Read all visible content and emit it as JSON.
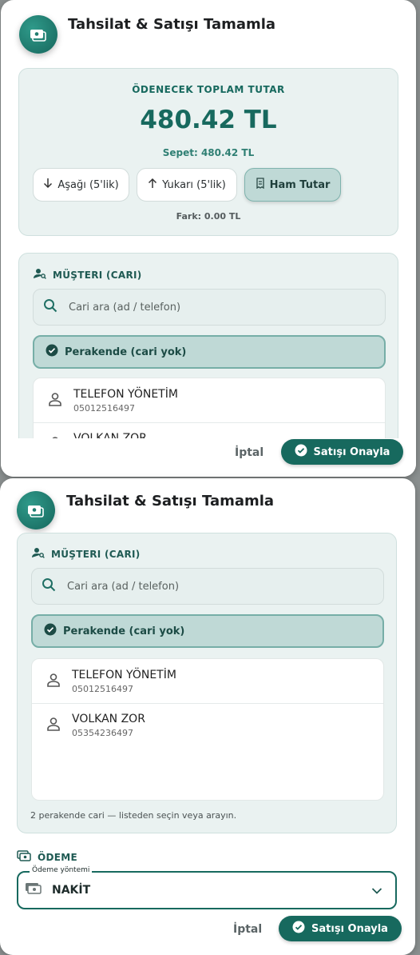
{
  "header": {
    "title": "Tahsilat & Satışı Tamamla",
    "icon": "cash-icon"
  },
  "total": {
    "label": "ÖDENECEK TOPLAM TUTAR",
    "amount": "480.42 TL",
    "basket": "Sepet: 480.42 TL",
    "round_down": "Aşağı (5'lik)",
    "round_up": "Yukarı (5'lik)",
    "raw": "Ham Tutar",
    "diff": "Fark: 0.00 TL"
  },
  "customer": {
    "title": "MÜŞTERI (CARI)",
    "search_placeholder": "Cari ara (ad / telefon)",
    "retail_label": "Perakende (cari yok)",
    "items": [
      {
        "name": "TELEFON YÖNETİM",
        "phone": "05012516497"
      },
      {
        "name": "VOLKAN ZOR",
        "phone": "05354236497"
      }
    ],
    "hint": "2 perakende cari — listeden seçin veya arayın."
  },
  "payment": {
    "title": "ÖDEME",
    "method_label": "Ödeme yöntemi",
    "method_value": "NAKİT"
  },
  "actions": {
    "cancel": "İptal",
    "confirm": "Satışı Onayla"
  },
  "colors": {
    "accent": "#17695e",
    "card_bg": "#eaf2f1",
    "selected_bg": "#bfd9d6"
  }
}
